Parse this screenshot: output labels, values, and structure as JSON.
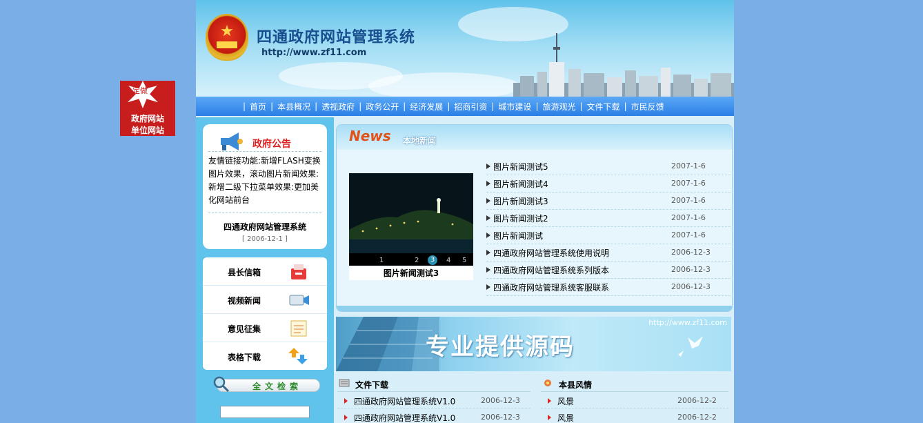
{
  "float_ad": {
    "line1": "定做",
    "line2": "政府网站",
    "line3": "单位网站"
  },
  "banner": {
    "title": "四通政府网站管理系统",
    "url": "http://www.zf11.com"
  },
  "nav": {
    "items": [
      "首页",
      "本县概况",
      "透视政府",
      "政务公开",
      "经济发展",
      "招商引资",
      "城市建设",
      "旅游观光",
      "文件下载",
      "市民反馈"
    ]
  },
  "notice": {
    "title": "政府公告",
    "body": "友情链接功能:新增FLASH变换图片效果，滚动图片新闻效果:新增二级下拉菜单效果:更加美化网站前台",
    "item_title": "四通政府网站管理系统",
    "item_date": "[ 2006-12-1 ]"
  },
  "quick_links": {
    "items": [
      "县长信箱",
      "视频新闻",
      "意见征集",
      "表格下载"
    ]
  },
  "search": {
    "label": "全文检索",
    "placeholder": ""
  },
  "news": {
    "heading_en": "News",
    "heading_cn": "本地新闻",
    "photo_caption": "图片新闻测试3",
    "photo_pages": [
      "1",
      "2",
      "3",
      "4",
      "5"
    ],
    "active_page": "3",
    "items": [
      {
        "title": "图片新闻测试5",
        "date": "2007-1-6"
      },
      {
        "title": "图片新闻测试4",
        "date": "2007-1-6"
      },
      {
        "title": "图片新闻测试3",
        "date": "2007-1-6"
      },
      {
        "title": "图片新闻测试2",
        "date": "2007-1-6"
      },
      {
        "title": "图片新闻测试",
        "date": "2007-1-6"
      },
      {
        "title": "四通政府网站管理系统使用说明",
        "date": "2006-12-3"
      },
      {
        "title": "四通政府网站管理系统系列版本",
        "date": "2006-12-3"
      },
      {
        "title": "四通政府网站管理系统客服联系",
        "date": "2006-12-3"
      }
    ]
  },
  "ad_banner": {
    "slogan": "专业提供源码",
    "url": "http://www.zf11.com"
  },
  "files": {
    "title": "文件下载",
    "items": [
      {
        "title": "四通政府网站管理系统V1.0",
        "date": "2006-12-3"
      },
      {
        "title": "四通政府网站管理系统V1.0",
        "date": "2006-12-3"
      }
    ]
  },
  "scenery": {
    "title": "本县风情",
    "items": [
      {
        "title": "风景",
        "date": "2006-12-2"
      },
      {
        "title": "风景",
        "date": "2006-12-2"
      }
    ]
  },
  "colors": {
    "page_bg": "#7aaee6",
    "nav_blue": "#2b7fe6",
    "accent_red": "#d22222",
    "news_orange": "#e0521a"
  }
}
